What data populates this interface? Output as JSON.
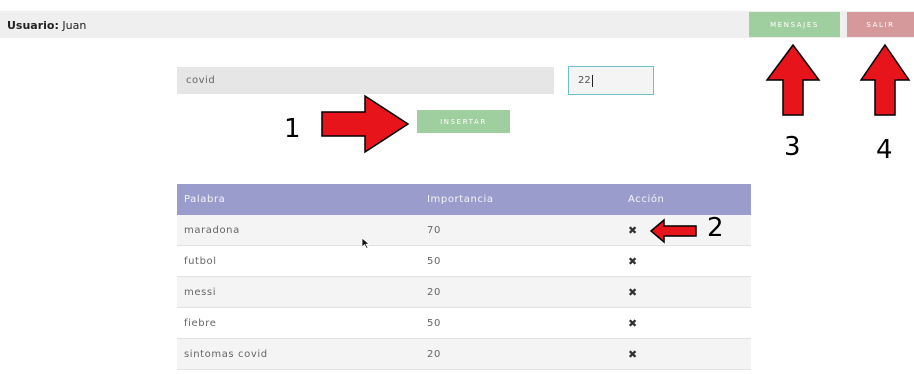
{
  "header": {
    "user_label": "Usuario:",
    "user_name": "Juan",
    "messages_button": "MENSAJES",
    "exit_button": "SALIR"
  },
  "form": {
    "word_value": "covid",
    "importance_value": "22",
    "insert_button": "INSERTAR"
  },
  "table": {
    "columns": [
      "Palabra",
      "Importancia",
      "Acción"
    ],
    "rows": [
      {
        "word": "maradona",
        "importance": "70",
        "action": "✖"
      },
      {
        "word": "futbol",
        "importance": "50",
        "action": "✖"
      },
      {
        "word": "messi",
        "importance": "20",
        "action": "✖"
      },
      {
        "word": "fiebre",
        "importance": "50",
        "action": "✖"
      },
      {
        "word": "sintomas covid",
        "importance": "20",
        "action": "✖"
      }
    ]
  },
  "annotations": {
    "labels": [
      "1",
      "2",
      "3",
      "4"
    ],
    "arrow_color": "#e8141b"
  },
  "colors": {
    "green_button": "#9fcf9f",
    "red_button": "#d6999b",
    "table_header": "#9a9dcc",
    "input_focus_border": "#6cc3c7"
  }
}
